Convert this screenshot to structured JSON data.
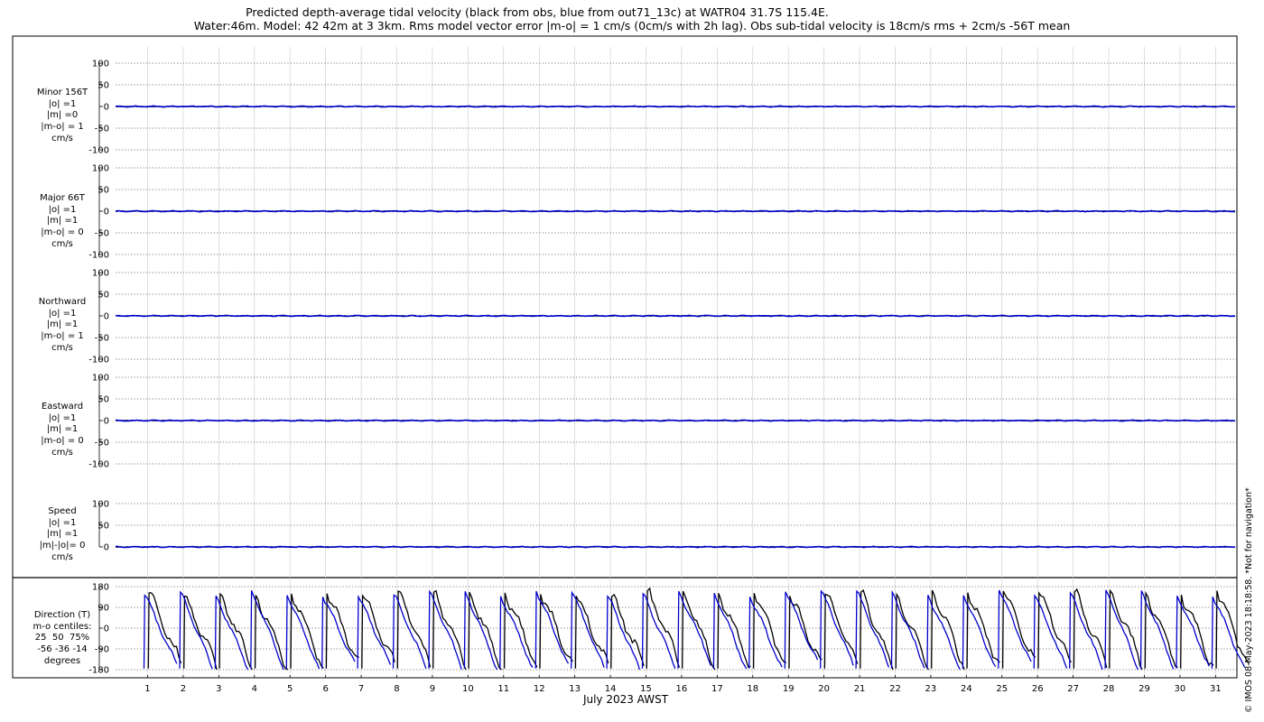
{
  "title_line1": "Predicted depth-average tidal velocity (black from obs, blue from out71_13c) at WATR04 31.7S 115.4E.",
  "title_line2": "Water:46m. Model: 42 42m at 3 3km. Rms model vector error |m-o| = 1 cm/s (0cm/s with 2h lag). Obs sub-tidal velocity is 18cm/s rms + 2cm/s -56T mean",
  "copyright": "© IMOS 08-May-2023 18:18:58. *Not for navigation*",
  "colors": {
    "observed": "#000000",
    "model": "#0000cc",
    "grid": "#9a9a9a"
  },
  "chart_data": {
    "type": "line",
    "xlabel": "July 2023 AWST",
    "x_ticks": [
      "1",
      "2",
      "3",
      "4",
      "5",
      "6",
      "7",
      "8",
      "9",
      "10",
      "11",
      "12",
      "13",
      "14",
      "15",
      "16",
      "17",
      "18",
      "19",
      "20",
      "21",
      "22",
      "23",
      "24",
      "25",
      "26",
      "27",
      "28",
      "29",
      "30",
      "31"
    ],
    "xlim_days": [
      0.1,
      31.6
    ],
    "series_names": [
      "obs",
      "out71_13c"
    ],
    "panels": [
      {
        "name": "Minor 156T",
        "label_lines": [
          "Minor 156T",
          "|o| =1",
          "|m| =0",
          "|m-o| = 1",
          "cm/s"
        ],
        "yticks": [
          "100",
          "50",
          "0",
          "-50",
          "-100"
        ],
        "ylim": [
          -100,
          100
        ],
        "obs_level": 0,
        "model_level": 0
      },
      {
        "name": "Major 66T",
        "label_lines": [
          "Major 66T",
          "|o| =1",
          "|m| =1",
          "|m-o| = 0",
          "cm/s"
        ],
        "yticks": [
          "100",
          "50",
          "0",
          "-50",
          "-100"
        ],
        "ylim": [
          -100,
          100
        ],
        "obs_level": 0,
        "model_level": 0
      },
      {
        "name": "Northward",
        "label_lines": [
          "Northward",
          "|o| =1",
          "|m| =1",
          "|m-o| = 1",
          "cm/s"
        ],
        "yticks": [
          "100",
          "50",
          "0",
          "-50",
          "-100"
        ],
        "ylim": [
          -100,
          100
        ],
        "obs_level": 0,
        "model_level": 0
      },
      {
        "name": "Eastward",
        "label_lines": [
          "Eastward",
          "|o| =1",
          "|m| =1",
          "|m-o| = 0",
          "cm/s"
        ],
        "yticks": [
          "100",
          "50",
          "0",
          "-50",
          "-100"
        ],
        "ylim": [
          -100,
          100
        ],
        "obs_level": 0,
        "model_level": 0
      },
      {
        "name": "Speed",
        "label_lines": [
          "Speed",
          "|o| =1",
          "|m| =1",
          "|m|-|o|= 0",
          "cm/s"
        ],
        "yticks": [
          "100",
          "50",
          "0"
        ],
        "ylim": [
          0,
          100
        ],
        "obs_level": 0,
        "model_level": 0
      },
      {
        "name": "Direction (T)",
        "label_lines": [
          "Direction (T)",
          "m-o centiles:",
          "25  50  75%",
          "-56 -36 -14",
          "degrees"
        ],
        "yticks": [
          "180",
          "90",
          "0",
          "-90",
          "-180"
        ],
        "ylim": [
          -180,
          180
        ],
        "description": "diurnal sawtooth: direction jumps from about -180 up to about +180 once per day, then decreases",
        "model_daily_jump_day": [
          0.9,
          1.9,
          2.9,
          3.9,
          4.9,
          5.9,
          6.9,
          7.9,
          8.9,
          9.9,
          10.9,
          11.9,
          12.9,
          13.9,
          14.9,
          15.9,
          16.9,
          17.9,
          18.9,
          19.9,
          20.9,
          21.9,
          22.9,
          23.9,
          24.9,
          25.9,
          26.9,
          27.9,
          28.9,
          29.9,
          30.9
        ]
      }
    ]
  }
}
